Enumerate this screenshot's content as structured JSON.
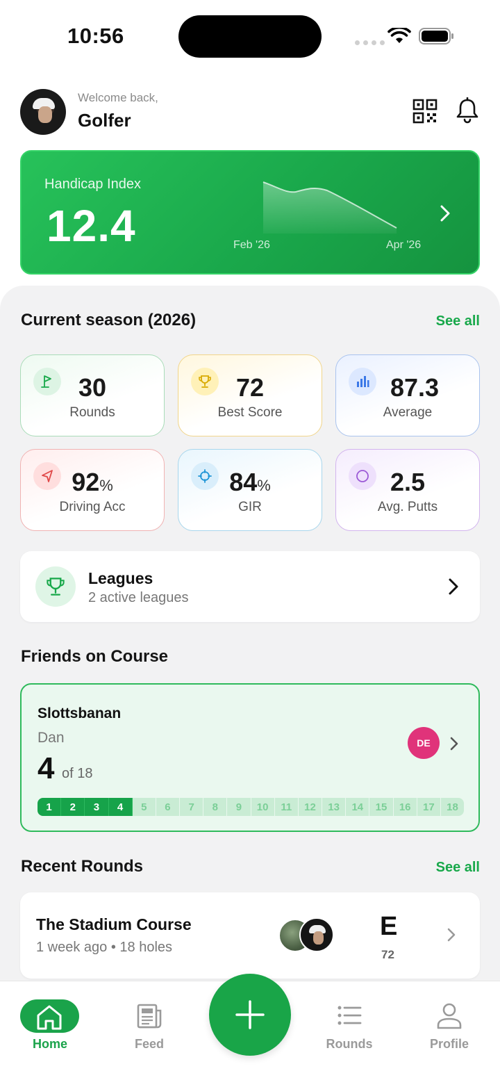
{
  "status_bar": {
    "time": "10:56"
  },
  "header": {
    "welcome": "Welcome back,",
    "username": "Golfer"
  },
  "handicap": {
    "label": "Handicap Index",
    "value": "12.4",
    "x_start": "Feb '26",
    "x_end": "Apr '26"
  },
  "season": {
    "title": "Current season (2026)",
    "see_all": "See all",
    "stats": [
      {
        "value": "30",
        "suffix": "",
        "label": "Rounds",
        "icon": "flag-icon",
        "color": "#18a84a"
      },
      {
        "value": "72",
        "suffix": "",
        "label": "Best Score",
        "icon": "trophy-icon",
        "color": "#d8a900"
      },
      {
        "value": "87.3",
        "suffix": "",
        "label": "Average",
        "icon": "bar-chart-icon",
        "color": "#3b78e7"
      },
      {
        "value": "92",
        "suffix": "%",
        "label": "Driving Acc",
        "icon": "navigation-arrow-icon",
        "color": "#e04848"
      },
      {
        "value": "84",
        "suffix": "%",
        "label": "GIR",
        "icon": "crosshair-icon",
        "color": "#1f95d6"
      },
      {
        "value": "2.5",
        "suffix": "",
        "label": "Avg. Putts",
        "icon": "circle-icon",
        "color": "#9b59d6"
      }
    ]
  },
  "leagues": {
    "title": "Leagues",
    "subtitle": "2 active leagues"
  },
  "friends": {
    "title": "Friends on Course",
    "course": "Slottsbanan",
    "player": "Dan",
    "hole": "4",
    "of_total": "of 18",
    "badge": "DE",
    "holes_completed": 4,
    "holes": [
      "1",
      "2",
      "3",
      "4",
      "5",
      "6",
      "7",
      "8",
      "9",
      "10",
      "11",
      "12",
      "13",
      "14",
      "15",
      "16",
      "17",
      "18"
    ]
  },
  "recent": {
    "title": "Recent Rounds",
    "see_all": "See all",
    "rounds": [
      {
        "course": "The Stadium Course",
        "when": "1 week ago",
        "holes": "18 holes",
        "score": "E",
        "strokes": "72"
      }
    ]
  },
  "nav": {
    "home": "Home",
    "feed": "Feed",
    "rounds": "Rounds",
    "profile": "Profile"
  }
}
